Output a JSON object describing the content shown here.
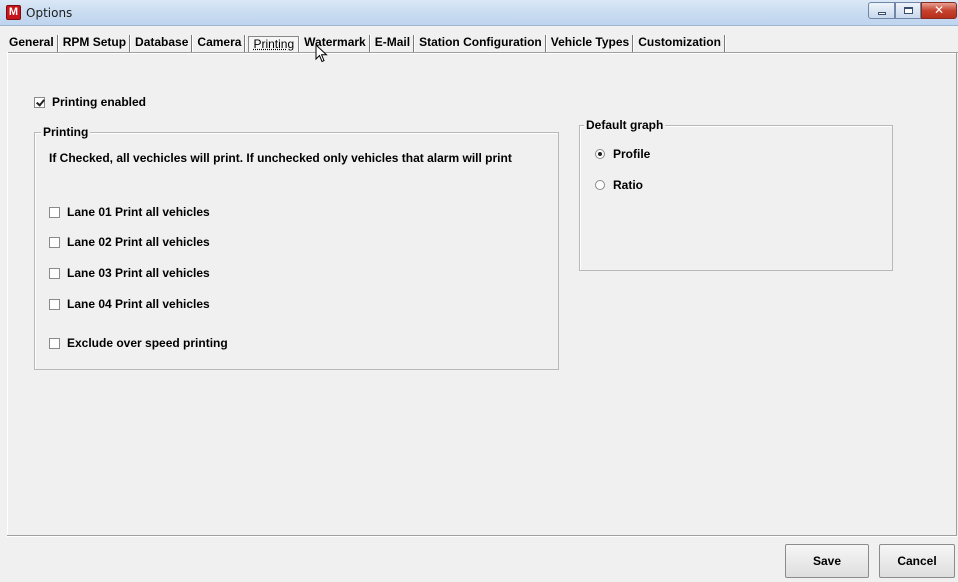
{
  "window": {
    "title": "Options",
    "app_icon_letter": "M"
  },
  "tabs": [
    {
      "label": "General"
    },
    {
      "label": "RPM Setup"
    },
    {
      "label": "Database"
    },
    {
      "label": "Camera"
    },
    {
      "label": "Printing",
      "selected": true
    },
    {
      "label": "Watermark"
    },
    {
      "label": "E-Mail"
    },
    {
      "label": "Station Configuration"
    },
    {
      "label": "Vehicle Types"
    },
    {
      "label": "Customization"
    }
  ],
  "printing_enabled": {
    "label": "Printing enabled",
    "checked": true
  },
  "printing_group": {
    "title": "Printing",
    "description": "If Checked, all vechicles will print.  If unchecked only vehicles that alarm will print",
    "lanes": [
      {
        "label": "Lane 01 Print all vehicles",
        "checked": false
      },
      {
        "label": "Lane 02 Print all vehicles",
        "checked": false
      },
      {
        "label": "Lane 03 Print all vehicles",
        "checked": false
      },
      {
        "label": "Lane 04 Print all vehicles",
        "checked": false
      }
    ],
    "exclude": {
      "label": "Exclude over speed printing",
      "checked": false
    }
  },
  "default_graph": {
    "title": "Default graph",
    "options": [
      {
        "label": "Profile",
        "selected": true
      },
      {
        "label": "Ratio",
        "selected": false
      }
    ]
  },
  "buttons": {
    "save": "Save",
    "cancel": "Cancel"
  }
}
